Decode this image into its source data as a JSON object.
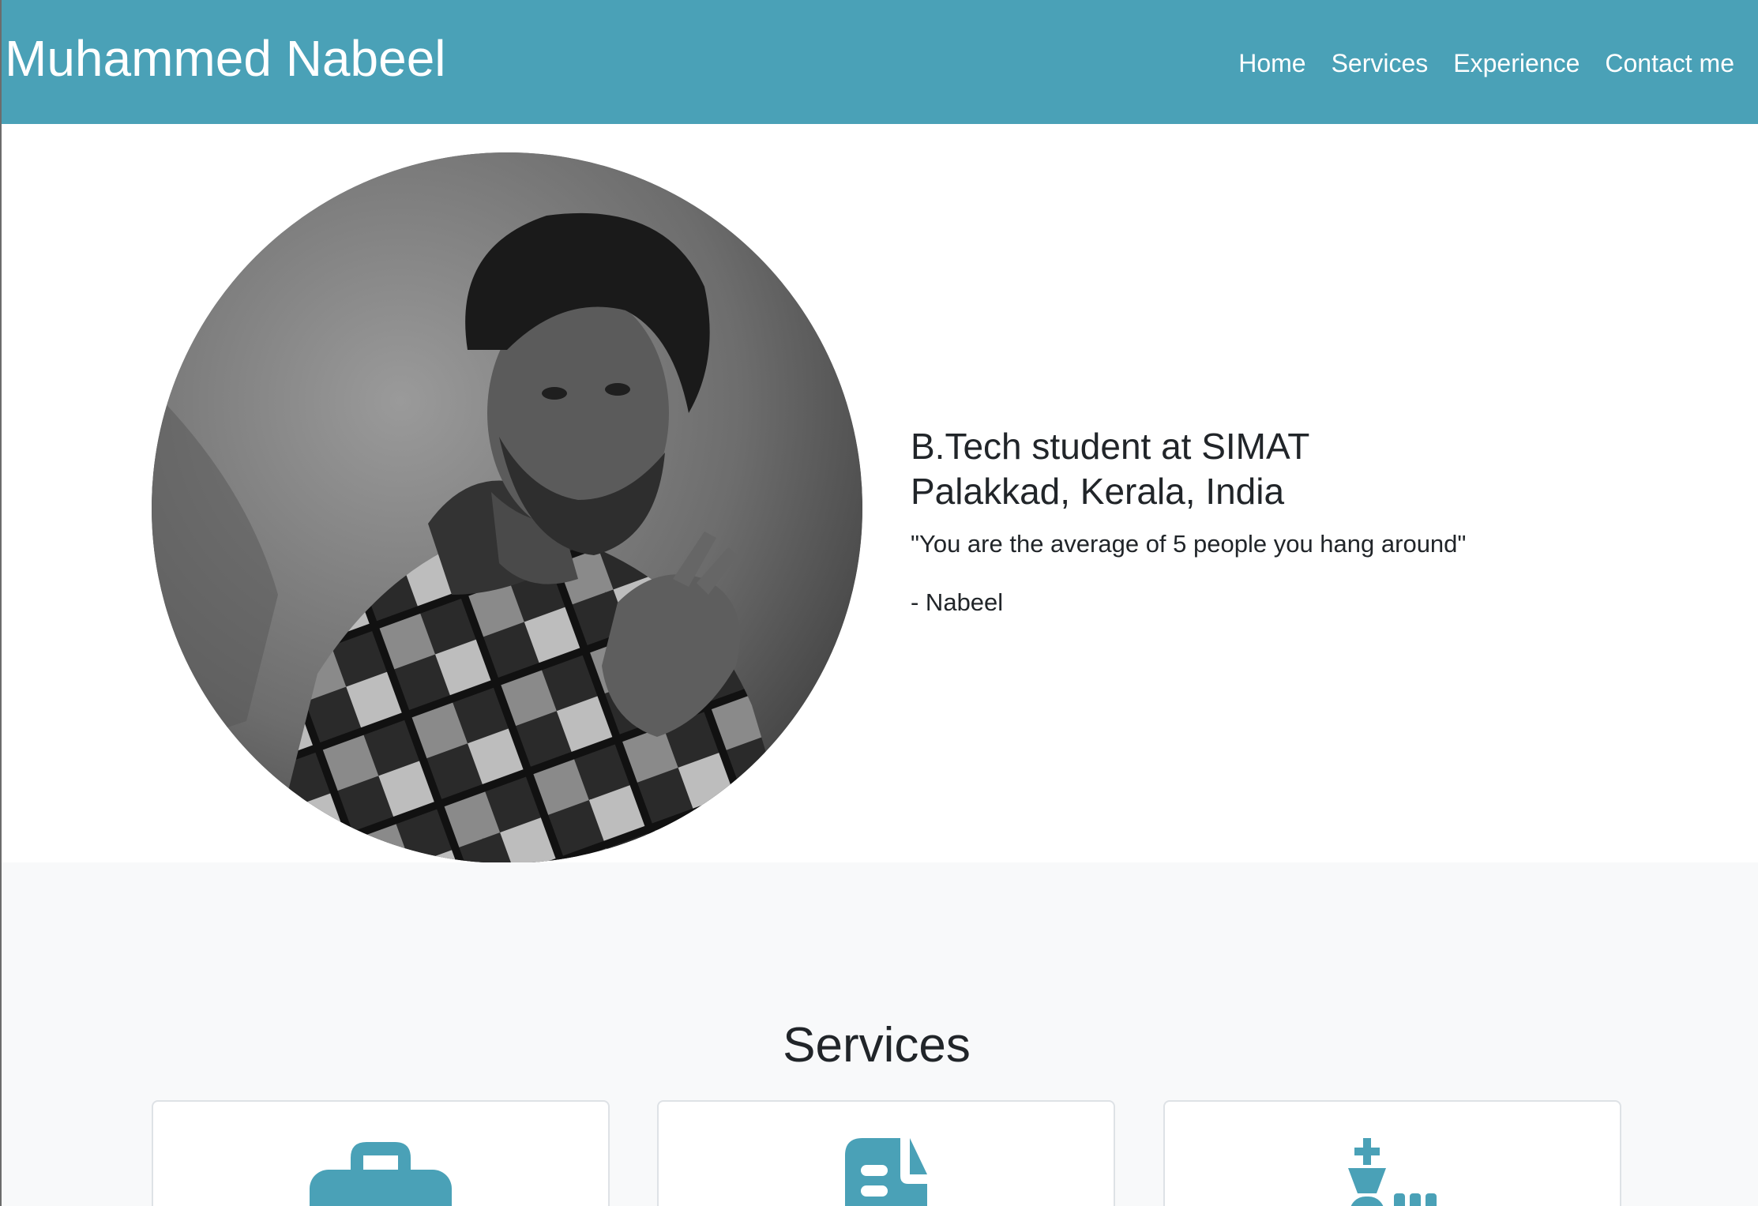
{
  "header": {
    "brand": "Muhammed Nabeel",
    "nav": [
      {
        "label": "Home"
      },
      {
        "label": "Services"
      },
      {
        "label": "Experience"
      },
      {
        "label": "Contact me"
      }
    ]
  },
  "hero": {
    "portrait_icon": "profile-photo",
    "line1": "B.Tech student at SIMAT",
    "line2": "Palakkad, Kerala, India",
    "quote": "\"You are the average of 5 people you hang around\"",
    "signature": "- Nabeel"
  },
  "services": {
    "title": "Services",
    "cards": [
      {
        "icon": "briefcase-icon"
      },
      {
        "icon": "document-icon"
      },
      {
        "icon": "chess-icon"
      }
    ]
  },
  "colors": {
    "navbar": "#4aa1b7",
    "accent_icon": "#4aa1b7",
    "services_bg": "#f8f9fa"
  }
}
